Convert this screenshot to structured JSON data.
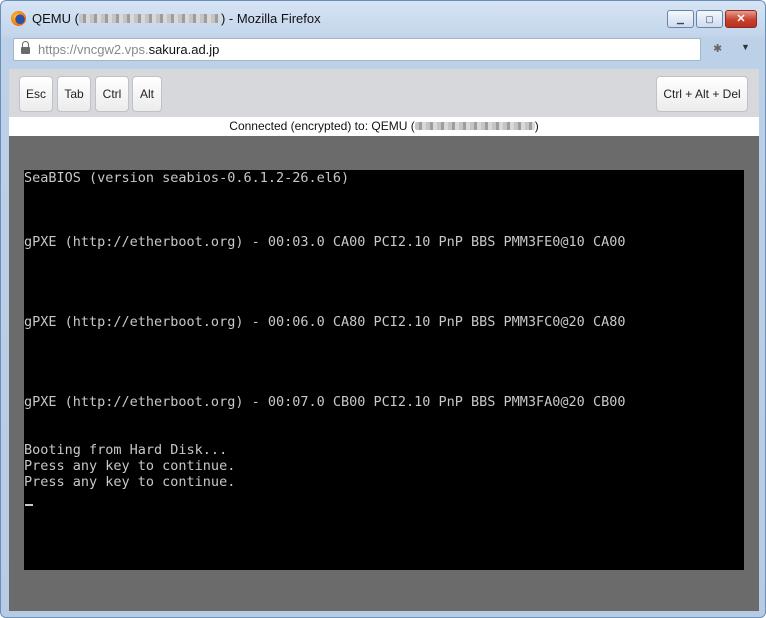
{
  "window": {
    "title_prefix": "QEMU (",
    "title_suffix": ") - Mozilla Firefox",
    "controls": {
      "minimize_icon": "minimize-icon",
      "maximize_icon": "maximize-icon",
      "close_icon": "close-icon",
      "minimize_glyph": "▁",
      "maximize_glyph": "▢",
      "close_glyph": "✕"
    }
  },
  "urlbar": {
    "scheme": "https://",
    "subdomain": "vncgw2.vps.",
    "domain": "sakura.ad.jp",
    "lock_icon": "lock-icon",
    "addon_glyph": "✱",
    "menu_glyph": "▼"
  },
  "toolbar": {
    "keys": [
      {
        "label": "Esc"
      },
      {
        "label": "Tab"
      },
      {
        "label": "Ctrl"
      },
      {
        "label": "Alt"
      }
    ],
    "cad_label": "Ctrl + Alt + Del"
  },
  "status": {
    "prefix": "Connected (encrypted) to: QEMU (",
    "suffix": ")"
  },
  "console": {
    "lines": [
      "SeaBIOS (version seabios-0.6.1.2-26.el6)",
      "gPXE (http://etherboot.org) - 00:03.0 CA00 PCI2.10 PnP BBS PMM3FE0@10 CA00",
      "gPXE (http://etherboot.org) - 00:06.0 CA80 PCI2.10 PnP BBS PMM3FC0@20 CA80",
      "gPXE (http://etherboot.org) - 00:07.0 CB00 PCI2.10 PnP BBS PMM3FA0@20 CB00",
      "Booting from Hard Disk...",
      "Press any key to continue.",
      "Press any key to continue."
    ]
  },
  "colors": {
    "console_bg": "#000000",
    "console_fg": "#c8c8c8",
    "vnc_frame": "#6b6b6b",
    "close_button": "#c8402d"
  }
}
